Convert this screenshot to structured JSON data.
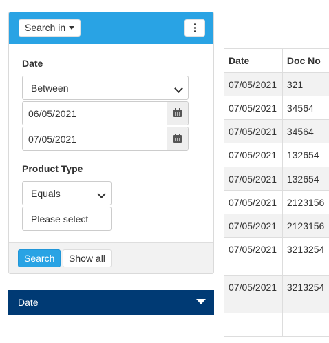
{
  "search_panel": {
    "search_in_label": "Search in",
    "date_label": "Date",
    "date_operator": "Between",
    "date_from": "06/05/2021",
    "date_to": "07/05/2021",
    "product_type_label": "Product Type",
    "product_type_operator": "Equals",
    "product_type_placeholder": "Please select",
    "search_button": "Search",
    "show_all_button": "Show all"
  },
  "accordion": {
    "title": "Date"
  },
  "grid": {
    "columns": [
      "Date",
      "Doc No"
    ],
    "rows": [
      [
        "07/05/2021",
        "321"
      ],
      [
        "07/05/2021",
        "34564"
      ],
      [
        "07/05/2021",
        "34564"
      ],
      [
        "07/05/2021",
        "132654"
      ],
      [
        "07/05/2021",
        "132654"
      ],
      [
        "07/05/2021",
        "2123156"
      ],
      [
        "07/05/2021",
        "2123156"
      ],
      [
        "07/05/2021",
        "3213254"
      ],
      [
        "07/05/2021",
        "3213254"
      ],
      [
        "",
        ""
      ]
    ]
  },
  "colors": {
    "primary": "#29a3e4",
    "accordion": "#003a74"
  }
}
